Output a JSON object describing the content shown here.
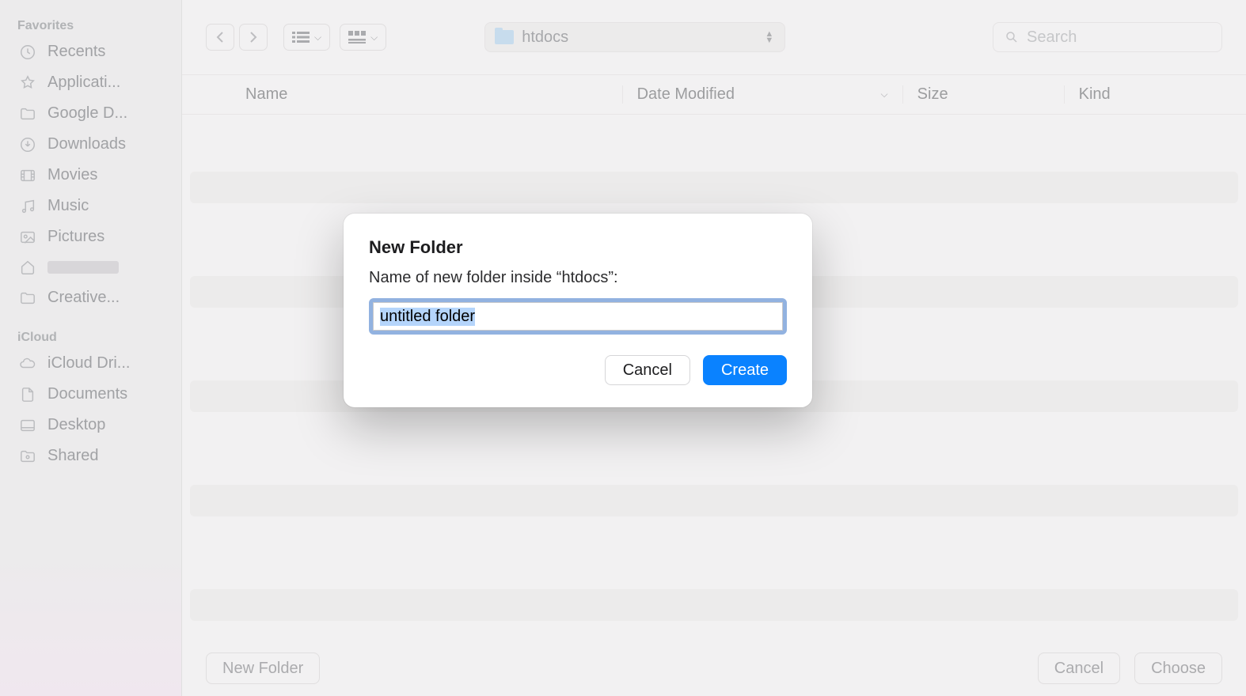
{
  "sidebar": {
    "favorites_header": "Favorites",
    "icloud_header": "iCloud",
    "favorites": [
      {
        "label": "Recents",
        "icon": "clock-icon"
      },
      {
        "label": "Applicati...",
        "icon": "app-icon"
      },
      {
        "label": "Google D...",
        "icon": "folder-icon"
      },
      {
        "label": "Downloads",
        "icon": "download-icon"
      },
      {
        "label": "Movies",
        "icon": "movie-icon"
      },
      {
        "label": "Music",
        "icon": "music-icon"
      },
      {
        "label": "Pictures",
        "icon": "picture-icon"
      },
      {
        "label": "",
        "icon": "home-icon",
        "redacted": true
      },
      {
        "label": "Creative...",
        "icon": "folder-icon"
      }
    ],
    "icloud_items": [
      {
        "label": "iCloud Dri...",
        "icon": "cloud-icon"
      },
      {
        "label": "Documents",
        "icon": "document-icon"
      },
      {
        "label": "Desktop",
        "icon": "desktop-icon"
      },
      {
        "label": "Shared",
        "icon": "shared-folder-icon"
      }
    ]
  },
  "toolbar": {
    "path_label": "htdocs",
    "search_placeholder": "Search"
  },
  "columns": {
    "name": "Name",
    "date_modified": "Date Modified",
    "size": "Size",
    "kind": "Kind"
  },
  "footer": {
    "new_folder": "New Folder",
    "cancel": "Cancel",
    "choose": "Choose"
  },
  "modal": {
    "title": "New Folder",
    "prompt": "Name of new folder inside “htdocs”:",
    "input_value": "untitled folder",
    "cancel": "Cancel",
    "create": "Create"
  }
}
